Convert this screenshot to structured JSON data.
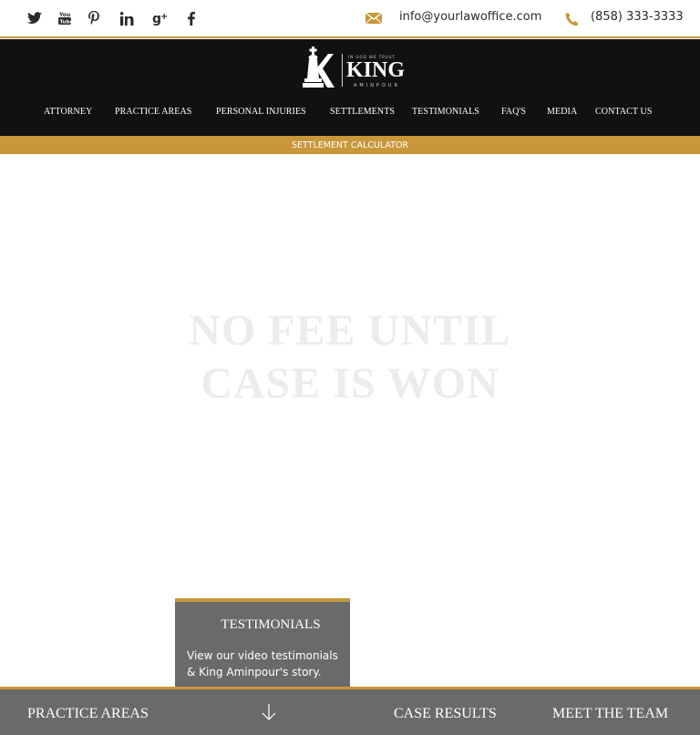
{
  "topbar": {
    "social_icons": [
      "twitter-icon",
      "youtube-icon",
      "pinterest-icon",
      "linkedin-icon",
      "google-plus-icon",
      "facebook-icon"
    ],
    "email": "info@yourlawoffice.com",
    "phone": "(858) 333-3333"
  },
  "logo": {
    "name": "KING",
    "tagline": "IN GOD WE TRUST",
    "subname": "AMINPOUR"
  },
  "nav": {
    "items": [
      {
        "label": "ATTORNEY"
      },
      {
        "label": "PRACTICE AREAS"
      },
      {
        "label": "PERSONAL INJURIES"
      },
      {
        "label": "SETTLEMENTS"
      },
      {
        "label": "TESTIMONIALS"
      },
      {
        "label": "FAQ'S"
      },
      {
        "label": "MEDIA"
      },
      {
        "label": "CONTACT US"
      }
    ]
  },
  "calculator": {
    "label": "SETTLEMENT CALCULATOR"
  },
  "hero": {
    "line1": "NO FEE UNTIL",
    "line2": "CASE IS WON"
  },
  "testimonials": {
    "title": "TESTIMONIALS",
    "text": "View our video testimonials & King Aminpour's story."
  },
  "bottom": {
    "practice_areas": "PRACTICE AREAS",
    "case_results": "CASE RESULTS",
    "meet_the_team": "MEET THE TEAM"
  },
  "colors": {
    "gold": "#c8973a",
    "dark": "#111111",
    "panel": "#6a6a6a"
  }
}
